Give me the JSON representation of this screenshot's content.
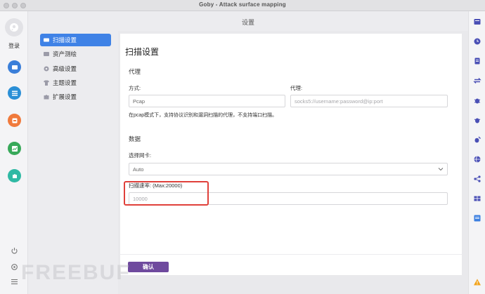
{
  "window": {
    "title": "Goby - Attack surface mapping"
  },
  "left_rail": {
    "login_label": "登录"
  },
  "settings": {
    "header_title": "设置"
  },
  "nav": {
    "items": [
      {
        "label": "扫描设置",
        "icon": "scan-icon",
        "active": true
      },
      {
        "label": "资产测绘",
        "icon": "asset-icon",
        "active": false
      },
      {
        "label": "高级设置",
        "icon": "gear-icon",
        "active": false
      },
      {
        "label": "主题设置",
        "icon": "shirt-icon",
        "active": false
      },
      {
        "label": "扩展设置",
        "icon": "puzzle-icon",
        "active": false
      }
    ]
  },
  "main": {
    "title": "扫描设置",
    "proxy_section": "代理",
    "mode_label": "方式:",
    "mode_value": "Pcap",
    "proxy_label": "代理:",
    "proxy_placeholder": "socks5://username:password@ip:port",
    "proxy_hint": "在pcap模式下，支持协议识别和漏洞扫描的代理，不支持端口扫描。",
    "data_section": "数据",
    "nic_label": "选择网卡:",
    "nic_value": "Auto",
    "rate_label": "扫描速率: (Max:20000)",
    "rate_placeholder": "10000",
    "confirm_label": "确认"
  },
  "colors": {
    "nav_active": "#3f82e6",
    "confirm_button": "#6f4a9e",
    "highlight_box": "#e0403a"
  },
  "watermark": "FREEBUF"
}
